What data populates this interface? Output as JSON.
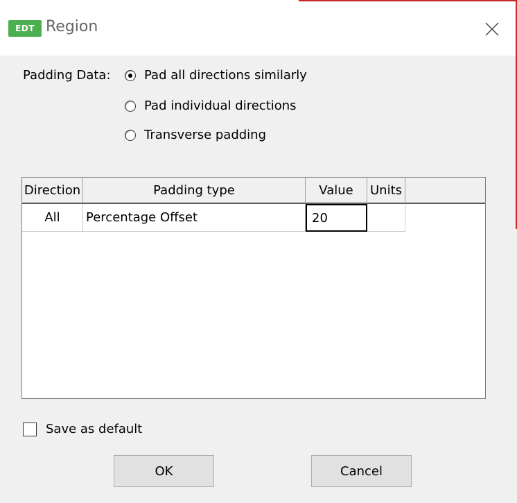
{
  "window": {
    "icon_text": "EDT",
    "title": "Region"
  },
  "padding": {
    "label": "Padding Data:",
    "options": [
      {
        "label": "Pad all directions similarly",
        "checked": true
      },
      {
        "label": "Pad individual directions",
        "checked": false
      },
      {
        "label": "Transverse padding",
        "checked": false
      }
    ]
  },
  "table": {
    "columns": [
      "Direction",
      "Padding type",
      "Value",
      "Units"
    ],
    "rows": [
      {
        "direction": "All",
        "padding_type": "Percentage Offset",
        "value": "20",
        "units": ""
      }
    ]
  },
  "save_default": {
    "label": "Save as default",
    "checked": false
  },
  "buttons": {
    "ok": "OK",
    "cancel": "Cancel"
  },
  "colors": {
    "accent_icon": "#4caf50",
    "edge_red": "#c62828"
  }
}
